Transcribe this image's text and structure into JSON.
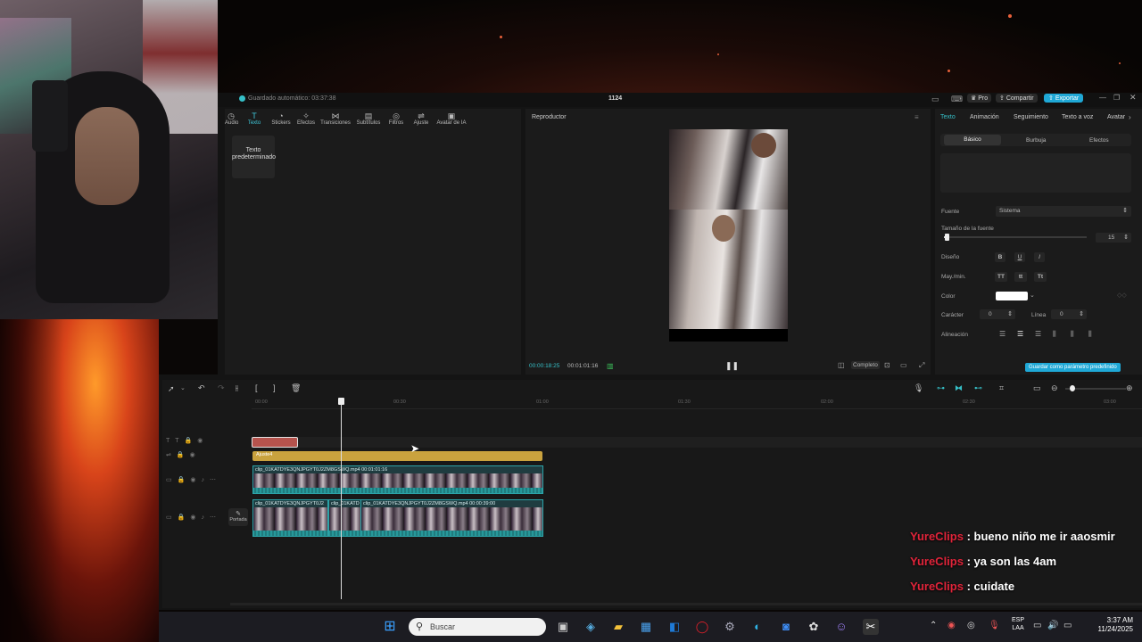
{
  "titlebar": {
    "autosave": "Guardado automático: 03:37:38",
    "project": "1124",
    "pro": "Pro",
    "share": "Compartir",
    "export": "Exportar"
  },
  "media_toolbar": [
    {
      "label": "Audio",
      "icon": "audio-icon"
    },
    {
      "label": "Texto",
      "icon": "text-icon"
    },
    {
      "label": "Stickers",
      "icon": "sticker-icon"
    },
    {
      "label": "Efectos",
      "icon": "effects-icon"
    },
    {
      "label": "Transiciones",
      "icon": "transitions-icon"
    },
    {
      "label": "Subtítulos",
      "icon": "subtitles-icon"
    },
    {
      "label": "Filtros",
      "icon": "filters-icon"
    },
    {
      "label": "Ajuste",
      "icon": "adjust-icon"
    },
    {
      "label": "Avatar de IA",
      "icon": "ai-avatar-icon"
    }
  ],
  "media_panel": {
    "default_text": "Texto predeterminado"
  },
  "player": {
    "title": "Reproductor",
    "current_time": "00:00:18:25",
    "total_time": "00:01:01:16",
    "ratio": "Completo"
  },
  "props": {
    "tabs": [
      "Texto",
      "Animación",
      "Seguimiento",
      "Texto a voz",
      "Avatar"
    ],
    "subtabs": [
      "Básico",
      "Burbuja",
      "Efectos"
    ],
    "font_label": "Fuente",
    "font_value": "Sistema",
    "size_label": "Tamaño de la fuente",
    "size_value": "15",
    "design_label": "Diseño",
    "case_label": "May./min.",
    "case_options": [
      "TT",
      "tt",
      "Tt"
    ],
    "color_label": "Color",
    "color_value": "#ffffff",
    "char_label": "Carácter",
    "char_value": "0",
    "line_label": "Línea",
    "line_value": "0",
    "align_label": "Alineación",
    "save_default": "Guardar como parámetro predefinido"
  },
  "timeline": {
    "ruler": [
      "00:00",
      "00:30",
      "01:00",
      "01:30",
      "02:00",
      "02:30",
      "03:00"
    ],
    "adjust_clip": "Ajuste4",
    "clip1_label": "clip_01KATDYE3QNJPGYT0J2ZM8GSWQ.mp4   00:01:01:16",
    "clip2a_label": "clip_01KATDYE3QNJPGYT0J2",
    "clip2b_label": "clip_01KATD",
    "clip2c_label": "clip_01KATDYE3QNJPGYT0J2ZM8GSWQ.mp4   00:00:39:00",
    "cover": "Portada"
  },
  "taskbar": {
    "search_placeholder": "Buscar",
    "lang": "ESP",
    "lang2": "LAA",
    "time": "3:37 AM",
    "date": "11/24/2025"
  },
  "chat": [
    {
      "user": "YureClips",
      "text": ": bueno niño me ir aaosmir"
    },
    {
      "user": "YureClips",
      "text": ": ya son las 4am"
    },
    {
      "user": "YureClips",
      "text": ": cuidate"
    }
  ]
}
